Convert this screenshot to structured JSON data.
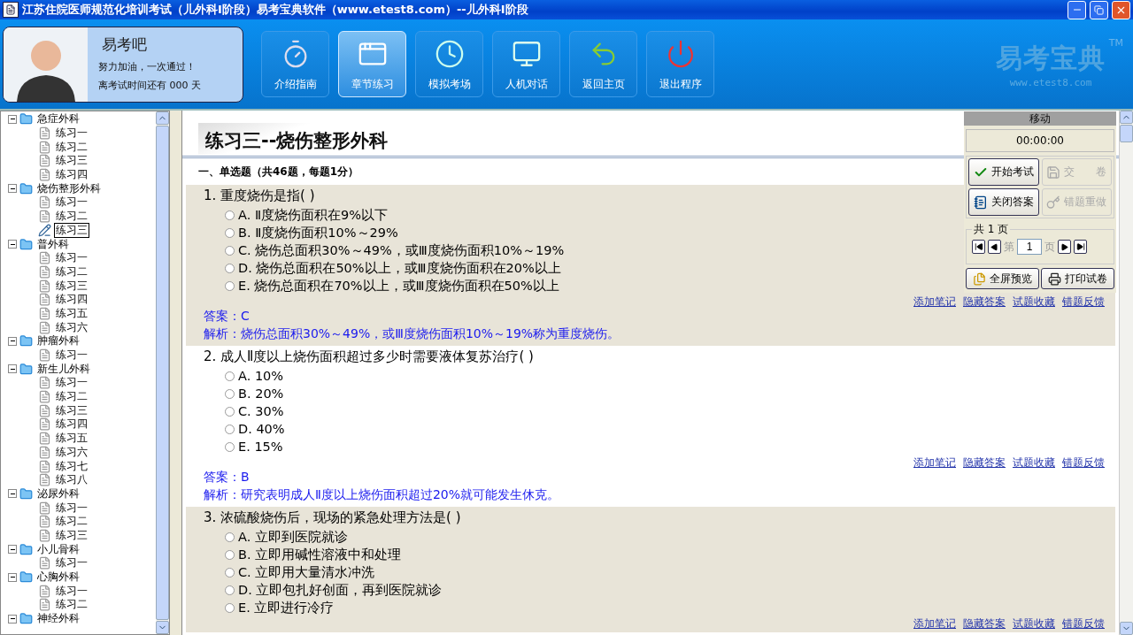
{
  "window": {
    "title": "江苏住院医师规范化培训考试（儿外科Ⅰ阶段）易考宝典软件（www.etest8.com）--儿外科Ⅰ阶段"
  },
  "profile": {
    "name": "易考吧",
    "slogan": "努力加油，一次通过！",
    "countdown": "离考试时间还有 000 天"
  },
  "toolbar": [
    {
      "label": "介绍指南",
      "kind": "stopwatch",
      "selected": false
    },
    {
      "label": "章节练习",
      "kind": "windows",
      "selected": true
    },
    {
      "label": "模拟考场",
      "kind": "clock",
      "selected": false
    },
    {
      "label": "人机对话",
      "kind": "computer",
      "selected": false
    },
    {
      "label": "返回主页",
      "kind": "back",
      "selected": false
    },
    {
      "label": "退出程序",
      "kind": "power",
      "selected": false
    }
  ],
  "brand": {
    "logo": "易考宝典",
    "mark": "TM",
    "url": "www.etest8.com"
  },
  "tree": [
    {
      "label": "急症外科",
      "expanded": true,
      "children": [
        {
          "label": "练习一",
          "selected": false
        },
        {
          "label": "练习二",
          "selected": false
        },
        {
          "label": "练习三",
          "selected": false
        },
        {
          "label": "练习四",
          "selected": false
        }
      ]
    },
    {
      "label": "烧伤整形外科",
      "expanded": true,
      "children": [
        {
          "label": "练习一",
          "selected": false
        },
        {
          "label": "练习二",
          "selected": false
        },
        {
          "label": "练习三",
          "selected": true
        }
      ]
    },
    {
      "label": "普外科",
      "expanded": true,
      "children": [
        {
          "label": "练习一",
          "selected": false
        },
        {
          "label": "练习二",
          "selected": false
        },
        {
          "label": "练习三",
          "selected": false
        },
        {
          "label": "练习四",
          "selected": false
        },
        {
          "label": "练习五",
          "selected": false
        },
        {
          "label": "练习六",
          "selected": false
        }
      ]
    },
    {
      "label": "肿瘤外科",
      "expanded": true,
      "children": [
        {
          "label": "练习一",
          "selected": false
        }
      ]
    },
    {
      "label": "新生儿外科",
      "expanded": true,
      "children": [
        {
          "label": "练习一",
          "selected": false
        },
        {
          "label": "练习二",
          "selected": false
        },
        {
          "label": "练习三",
          "selected": false
        },
        {
          "label": "练习四",
          "selected": false
        },
        {
          "label": "练习五",
          "selected": false
        },
        {
          "label": "练习六",
          "selected": false
        },
        {
          "label": "练习七",
          "selected": false
        },
        {
          "label": "练习八",
          "selected": false
        }
      ]
    },
    {
      "label": "泌尿外科",
      "expanded": true,
      "children": [
        {
          "label": "练习一",
          "selected": false
        },
        {
          "label": "练习二",
          "selected": false
        },
        {
          "label": "练习三",
          "selected": false
        }
      ]
    },
    {
      "label": "小儿骨科",
      "expanded": true,
      "children": [
        {
          "label": "练习一",
          "selected": false
        }
      ]
    },
    {
      "label": "心胸外科",
      "expanded": true,
      "children": [
        {
          "label": "练习一",
          "selected": false
        },
        {
          "label": "练习二",
          "selected": false
        }
      ]
    },
    {
      "label": "神经外科",
      "expanded": true
    }
  ],
  "exam": {
    "title": "练习三--烧伤整形外科",
    "section": "一、单选题（共46题，每题1分）",
    "questions": [
      {
        "number": "1.",
        "stem": "重度烧伤是指( )",
        "options": [
          {
            "letter": "A.",
            "text": "Ⅱ度烧伤面积在9%以下",
            "selected": false
          },
          {
            "letter": "B.",
            "text": "Ⅱ度烧伤面积10%～29%",
            "selected": false
          },
          {
            "letter": "C.",
            "text": "烧伤总面积30%～49%，或Ⅲ度烧伤面积10%～19%",
            "selected": false
          },
          {
            "letter": "D.",
            "text": "烧伤总面积在50%以上，或Ⅲ度烧伤面积在20%以上",
            "selected": false
          },
          {
            "letter": "E.",
            "text": "烧伤总面积在70%以上，或Ⅲ度烧伤面积在50%以上",
            "selected": false
          }
        ],
        "links": [
          "添加笔记",
          "隐藏答案",
          "试题收藏",
          "错题反馈"
        ],
        "answer": "答案：C",
        "analysis": "解析：烧伤总面积30%～49%，或Ⅲ度烧伤面积10%～19%称为重度烧伤。"
      },
      {
        "number": "2.",
        "stem": "成人Ⅱ度以上烧伤面积超过多少时需要液体复苏治疗( )",
        "options": [
          {
            "letter": "A.",
            "text": "10%",
            "selected": false
          },
          {
            "letter": "B.",
            "text": "20%",
            "selected": false
          },
          {
            "letter": "C.",
            "text": "30%",
            "selected": false
          },
          {
            "letter": "D.",
            "text": "40%",
            "selected": false
          },
          {
            "letter": "E.",
            "text": "15%",
            "selected": false
          }
        ],
        "links": [
          "添加笔记",
          "隐藏答案",
          "试题收藏",
          "错题反馈"
        ],
        "answer": "答案：B",
        "analysis": "解析：研究表明成人Ⅱ度以上烧伤面积超过20%就可能发生休克。"
      },
      {
        "number": "3.",
        "stem": "浓硫酸烧伤后，现场的紧急处理方法是( )",
        "options": [
          {
            "letter": "A.",
            "text": "立即到医院就诊",
            "selected": false
          },
          {
            "letter": "B.",
            "text": "立即用碱性溶液中和处理",
            "selected": false
          },
          {
            "letter": "C.",
            "text": "立即用大量清水冲洗",
            "selected": false
          },
          {
            "letter": "D.",
            "text": "立即包扎好创面，再到医院就诊",
            "selected": false
          },
          {
            "letter": "E.",
            "text": "立即进行冷疗",
            "selected": false
          }
        ],
        "links": [
          "添加笔记",
          "隐藏答案",
          "试题收藏",
          "错题反馈"
        ]
      }
    ]
  },
  "panel": {
    "header": "移动",
    "timer": "00:00:00",
    "buttons": [
      {
        "label": "开始考试",
        "kind": "check",
        "disabled": false
      },
      {
        "label": "交　　卷",
        "kind": "disk",
        "disabled": true
      },
      {
        "label": "关闭答案",
        "kind": "notepad",
        "disabled": false
      },
      {
        "label": "错题重做",
        "kind": "key",
        "disabled": true
      }
    ],
    "pager": {
      "total": "共 1 页",
      "before": "第",
      "page": "1",
      "after": "页"
    },
    "actions": [
      {
        "label": "全屏预览",
        "kind": "preview"
      },
      {
        "label": "打印试卷",
        "kind": "printer"
      }
    ]
  }
}
